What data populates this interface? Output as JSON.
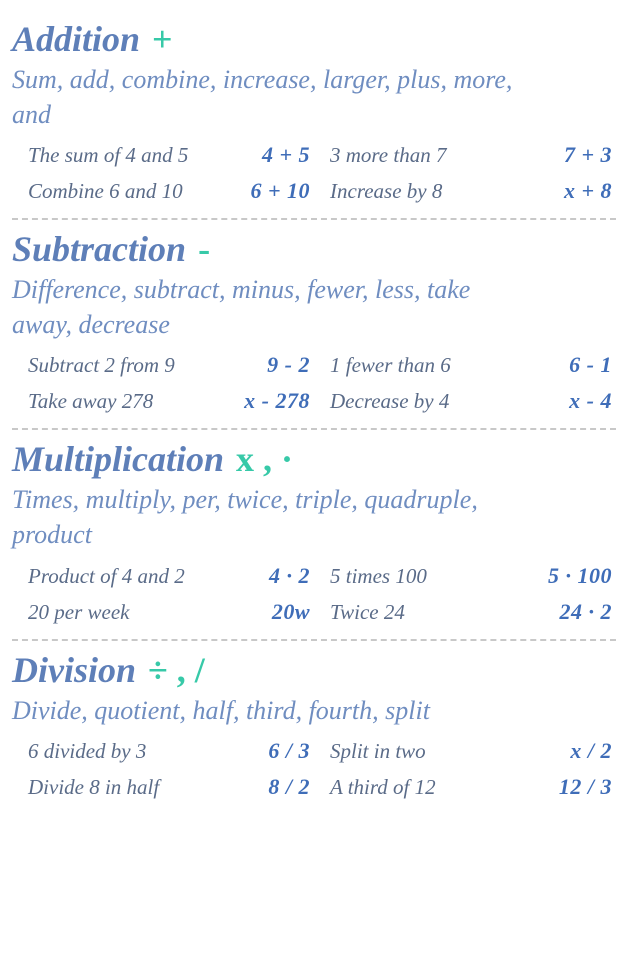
{
  "sections": [
    {
      "title": "Addition",
      "symbol": "+",
      "keywords": "Sum, add, combine, increase, larger, plus, more, and",
      "examples": [
        {
          "phrase": "The sum of 4 and 5",
          "expr": "4 + 5"
        },
        {
          "phrase": "3 more than 7",
          "expr": "7 + 3"
        },
        {
          "phrase": "Combine 6 and 10",
          "expr": "6 + 10"
        },
        {
          "phrase": "Increase by 8",
          "expr": "x + 8"
        }
      ]
    },
    {
      "title": "Subtraction",
      "symbol": "-",
      "keywords": "Difference, subtract, minus, fewer, less, take away, decrease",
      "examples": [
        {
          "phrase": "Subtract 2 from 9",
          "expr": "9 - 2"
        },
        {
          "phrase": "1 fewer than 6",
          "expr": "6 - 1"
        },
        {
          "phrase": "Take away 278",
          "expr": "x - 278"
        },
        {
          "phrase": "Decrease by 4",
          "expr": "x - 4"
        }
      ]
    },
    {
      "title": "Multiplication",
      "symbol": "x , ·",
      "keywords": "Times, multiply, per, twice, triple, quadruple, product",
      "examples": [
        {
          "phrase": "Product of 4 and 2",
          "expr": "4 · 2"
        },
        {
          "phrase": "5 times 100",
          "expr": "5 · 100"
        },
        {
          "phrase": "20 per week",
          "expr": "20w"
        },
        {
          "phrase": "Twice 24",
          "expr": "24 · 2"
        }
      ]
    },
    {
      "title": "Division",
      "symbol": "÷ , /",
      "keywords": "Divide, quotient, half, third, fourth, split",
      "examples": [
        {
          "phrase": "6 divided by 3",
          "expr": "6 / 3"
        },
        {
          "phrase": "Split in two",
          "expr": "x / 2"
        },
        {
          "phrase": "Divide 8 in half",
          "expr": "8 / 2"
        },
        {
          "phrase": "A third of 12",
          "expr": "12 / 3"
        }
      ]
    }
  ]
}
